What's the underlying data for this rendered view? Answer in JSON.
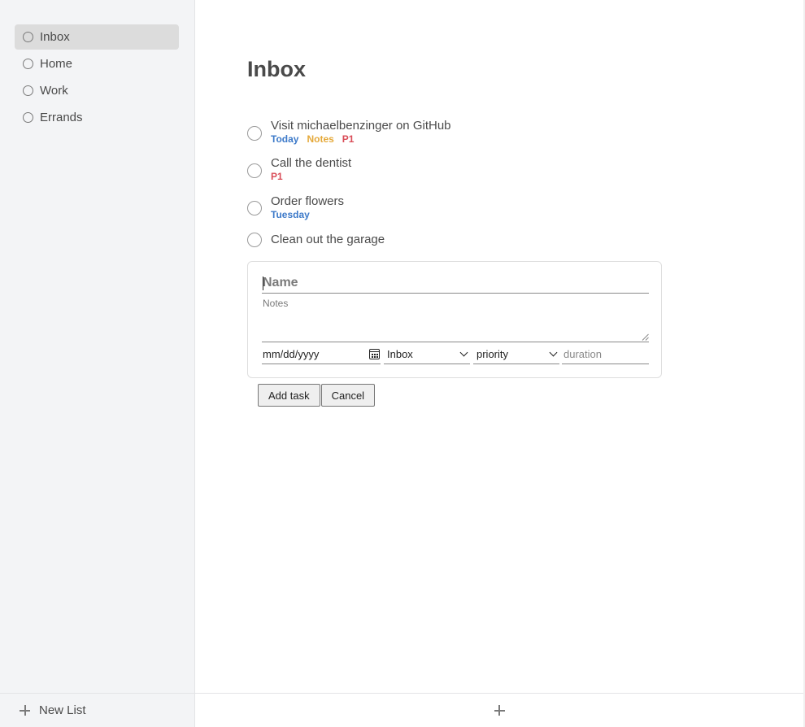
{
  "sidebar": {
    "lists": [
      {
        "label": "Inbox",
        "active": true
      },
      {
        "label": "Home",
        "active": false
      },
      {
        "label": "Work",
        "active": false
      },
      {
        "label": "Errands",
        "active": false
      }
    ],
    "new_list_label": "New List"
  },
  "main": {
    "title": "Inbox",
    "tasks": [
      {
        "name": "Visit michaelbenzinger on GitHub",
        "tags": {
          "date": "Today",
          "notes": "Notes",
          "priority": "P1"
        }
      },
      {
        "name": "Call the dentist",
        "tags": {
          "priority": "P1"
        }
      },
      {
        "name": "Order flowers",
        "tags": {
          "date": "Tuesday"
        }
      },
      {
        "name": "Clean out the garage",
        "tags": {}
      }
    ],
    "form": {
      "name_placeholder": "Name",
      "notes_placeholder": "Notes",
      "date_placeholder": "mm/dd/yyyy",
      "list_value": "Inbox",
      "priority_value": "priority",
      "duration_placeholder": "duration",
      "add_label": "Add task",
      "cancel_label": "Cancel"
    }
  },
  "colors": {
    "sidebar_bg": "#f3f4f6",
    "active_item_bg": "#dcdcdc",
    "date_tag": "#3d7ac9",
    "notes_tag": "#e5a93a",
    "priority_tag": "#d94c57"
  }
}
